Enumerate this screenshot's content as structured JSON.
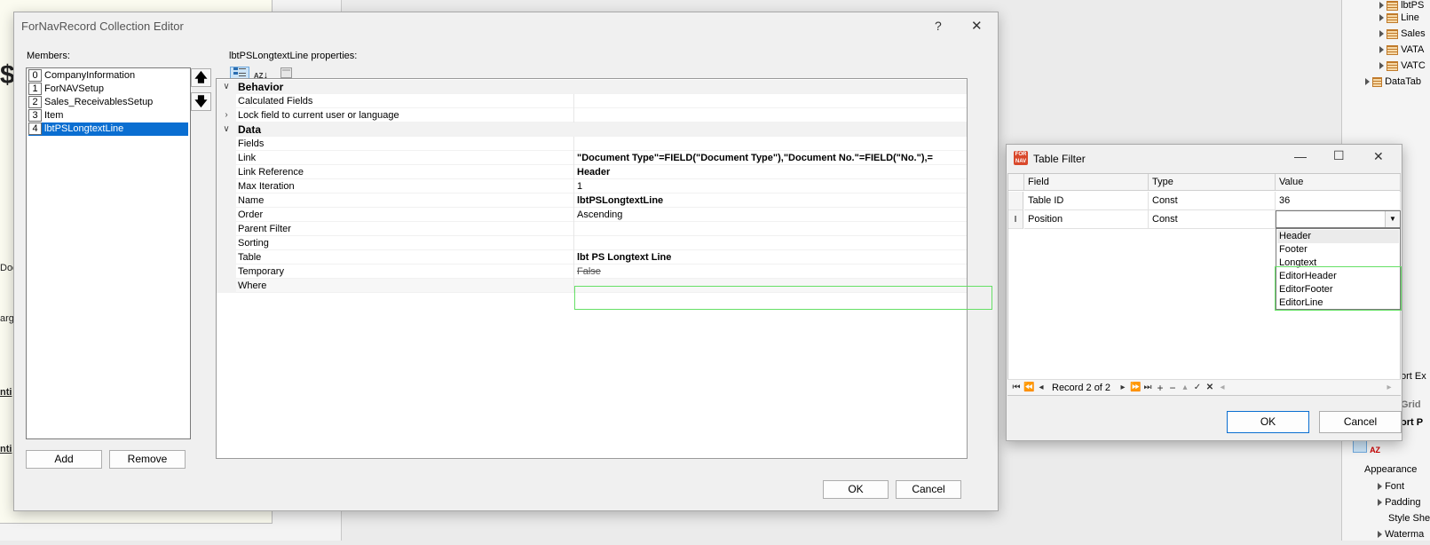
{
  "background": {
    "report_marks": [
      "$(",
      "Doc",
      "arg",
      "nti",
      "nti"
    ],
    "right_panel": {
      "tree_items": [
        "lbtPS",
        "Line",
        "Sales",
        "VATA",
        "VATC",
        "DataTab"
      ],
      "cut_texts": [
        "ort Ex",
        "Grid",
        "ort P"
      ],
      "properties": [
        "Appearance",
        "Font",
        "Padding",
        "Style She",
        "Waterma"
      ]
    }
  },
  "editor": {
    "title": "ForNavRecord Collection Editor",
    "help_glyph": "?",
    "close_glyph": "✕",
    "members_label": "Members:",
    "members": [
      {
        "index": "0",
        "name": "CompanyInformation"
      },
      {
        "index": "1",
        "name": "ForNAVSetup"
      },
      {
        "index": "2",
        "name": "Sales_ReceivablesSetup"
      },
      {
        "index": "3",
        "name": "Item"
      },
      {
        "index": "4",
        "name": "lbtPSLongtextLine"
      }
    ],
    "selected_member": 4,
    "move_up_glyph": "🡅",
    "move_down_glyph": "🡇",
    "add_label": "Add",
    "remove_label": "Remove",
    "properties_label": "lbtPSLongtextLine properties:",
    "sort_alpha_text": "AZ",
    "properties": {
      "behavior_category": "Behavior",
      "calculated_fields": "Calculated Fields",
      "lock_field": "Lock field to current user or language",
      "data_category": "Data",
      "fields": "Fields",
      "link": {
        "name": "Link",
        "value": "\"Document Type\"=FIELD(\"Document Type\"),\"Document No.\"=FIELD(\"No.\"),="
      },
      "link_reference": {
        "name": "Link Reference",
        "value": "Header"
      },
      "max_iteration": {
        "name": "Max Iteration",
        "value": "1"
      },
      "name_prop": {
        "name": "Name",
        "value": "lbtPSLongtextLine"
      },
      "order": {
        "name": "Order",
        "value": "Ascending"
      },
      "parent_filter": {
        "name": "Parent Filter",
        "value": ""
      },
      "sorting": {
        "name": "Sorting",
        "value": ""
      },
      "table": {
        "name": "Table",
        "value": "lbt PS Longtext Line"
      },
      "temporary": {
        "name": "Temporary",
        "value": "False"
      },
      "where": {
        "name": "Where",
        "value": ""
      }
    },
    "ok_label": "OK",
    "cancel_label": "Cancel"
  },
  "table_filter": {
    "title": "Table Filter",
    "app_icon_text": "FOR NAV",
    "minimize_glyph": "—",
    "maximize_glyph": "☐",
    "close_glyph": "✕",
    "columns": [
      "Field",
      "Type",
      "Value"
    ],
    "rows": [
      {
        "field": "Table ID",
        "type": "Const",
        "value": "36"
      },
      {
        "field": "Position",
        "type": "Const",
        "value": ""
      }
    ],
    "row_indicator": "I",
    "dropdown_glyph": "▼",
    "dropdown_options": [
      "Header",
      "Footer",
      "Longtext",
      "EditorHeader",
      "EditorFooter",
      "EditorLine"
    ],
    "record_text": "Record 2 of 2",
    "nav_glyphs": {
      "first": "⏮",
      "prev_page": "⏪",
      "prev": "◂",
      "next": "▸",
      "next_page": "⏩",
      "last": "⏭",
      "add": "+",
      "delete": "−",
      "up": "▴",
      "confirm": "✓",
      "cancel": "✕",
      "left": "◂",
      "right": "▸"
    },
    "ok_label": "OK",
    "cancel_label": "Cancel"
  }
}
